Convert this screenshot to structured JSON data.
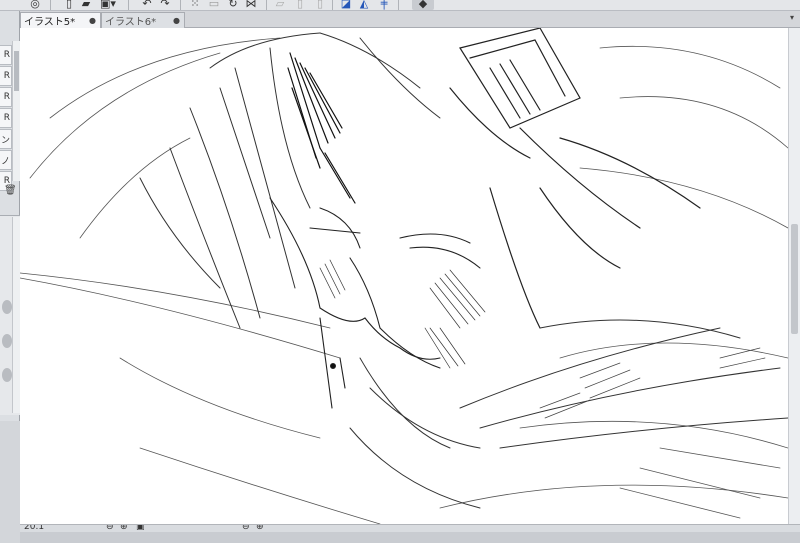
{
  "toolbar": {
    "icons": [
      "settings-icon",
      "new-file-icon",
      "open-icon",
      "save-icon",
      "undo-icon",
      "redo-icon",
      "select-icon",
      "transform-icon",
      "lasso-icon",
      "snap-icon",
      "ruler-icon",
      "help-icon"
    ]
  },
  "tabs": [
    {
      "label": "イラスト5*",
      "close": "●",
      "active": true
    },
    {
      "label": "イラスト6*",
      "close": "●",
      "active": false
    }
  ],
  "tab_menu_arrow": "▾",
  "left_panel": {
    "items": [
      "R",
      "R",
      "R",
      "R",
      "ン",
      "ノ",
      "R"
    ],
    "trash_glyph": "🗑"
  },
  "status": {
    "zoom": "20.1",
    "icons": [
      "zoom-out-icon",
      "zoom-in-icon",
      "fit-icon",
      "rotate-left-icon",
      "rotate-right-icon"
    ]
  }
}
